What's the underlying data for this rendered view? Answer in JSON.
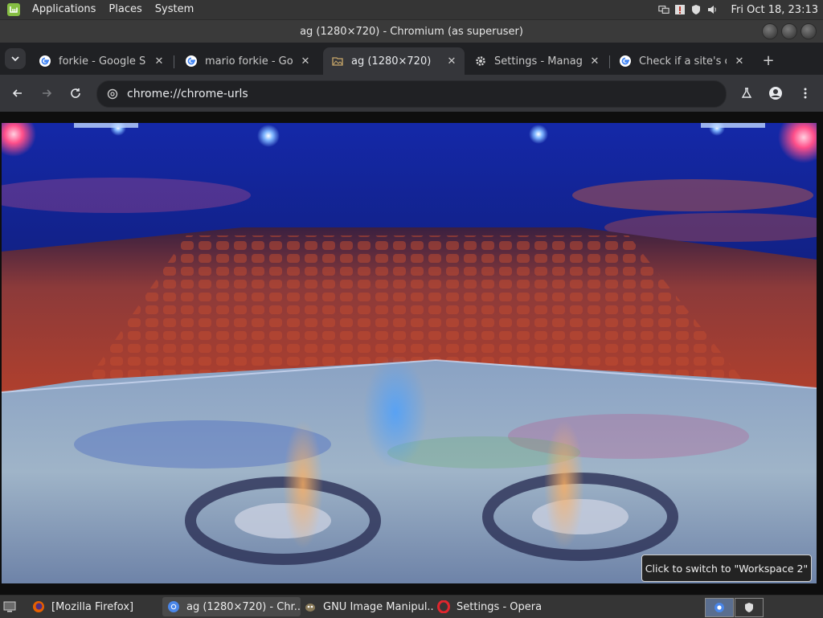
{
  "top_panel": {
    "menu": [
      "Applications",
      "Places",
      "System"
    ],
    "clock": "Fri Oct 18, 23:13"
  },
  "window": {
    "title": "ag (1280×720) - Chromium (as superuser)"
  },
  "tabs": [
    {
      "title": "forkie - Google Search",
      "favicon": "google-icon",
      "active": false
    },
    {
      "title": "mario forkie - Google Search",
      "favicon": "google-icon",
      "active": false
    },
    {
      "title": "ag (1280×720)",
      "favicon": "image-file-icon",
      "active": true
    },
    {
      "title": "Settings - Manage",
      "favicon": "gear-icon",
      "active": false
    },
    {
      "title": "Check if a site's co",
      "favicon": "google-icon",
      "active": false
    }
  ],
  "toolbar": {
    "url": "chrome://chrome-urls"
  },
  "tooltip": {
    "text": "Click to switch to \"Workspace 2\""
  },
  "taskbar": {
    "tasks": [
      {
        "label": "[Mozilla Firefox]",
        "icon": "firefox-icon"
      },
      {
        "label": "ag (1280×720) - Chr...",
        "icon": "chromium-icon"
      },
      {
        "label": "GNU Image Manipul...",
        "icon": "gimp-icon"
      },
      {
        "label": "Settings - Opera",
        "icon": "opera-icon"
      }
    ]
  },
  "colors": {
    "accent_mint": "#86be43",
    "chrome_dark": "#202124",
    "chrome_toolbar": "#35363a"
  }
}
